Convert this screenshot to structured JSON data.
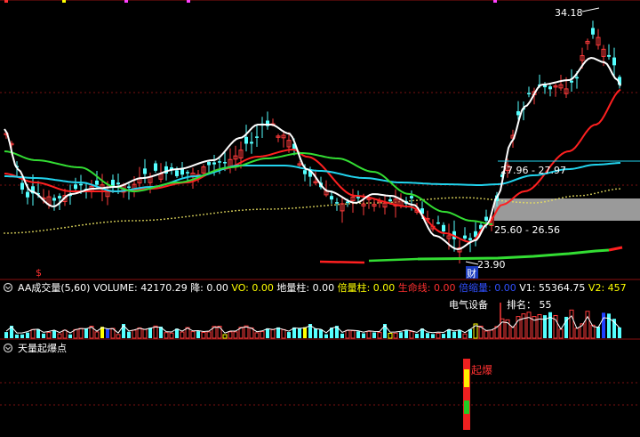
{
  "chart_data": [
    {
      "type": "candlestick",
      "price_labels": {
        "high": "34.18",
        "low": "23.90",
        "range_upper": "27.96 - 27.97",
        "range_lower": "25.60 - 26.56"
      },
      "markers": {
        "dollar": "$",
        "finance": "财"
      },
      "colors": {
        "up": "#ff3b3b",
        "down": "#54ffff",
        "ma_white": "#ffffff",
        "ma_red": "#ff2020",
        "ma_green": "#33dd33",
        "ma_cyan": "#22d4ee",
        "dots": "#e8e060",
        "highlight_band": "#9a9a9a"
      }
    },
    {
      "type": "bar",
      "indicator": {
        "name": "AA成交量(5,60)",
        "items": [
          {
            "label": "VOLUME:",
            "value": "42170.29",
            "color": "#ffffff"
          },
          {
            "label": "降:",
            "value": "0.00",
            "color": "#ffffff"
          },
          {
            "label": "VO:",
            "value": "0.00",
            "color": "#ffff00"
          },
          {
            "label": "地量柱:",
            "value": "0.00",
            "color": "#ffffff"
          },
          {
            "label": "倍量柱:",
            "value": "0.00",
            "color": "#ffff00"
          },
          {
            "label": "生命线:",
            "value": "0.00",
            "color": "#ff3030"
          },
          {
            "label": "倍缩量:",
            "value": "0.00",
            "color": "#3050ff"
          },
          {
            "label": "V1:",
            "value": "55364.75",
            "color": "#ffffff"
          },
          {
            "label": "V2:",
            "value": "457",
            "color": "#ffff00"
          }
        ]
      },
      "sector_label": "电气设备",
      "rank_label": "排名：",
      "rank_value": "55"
    },
    {
      "type": "bar",
      "indicator": {
        "name": "天量起爆点"
      },
      "signal_text": "起爆"
    }
  ]
}
